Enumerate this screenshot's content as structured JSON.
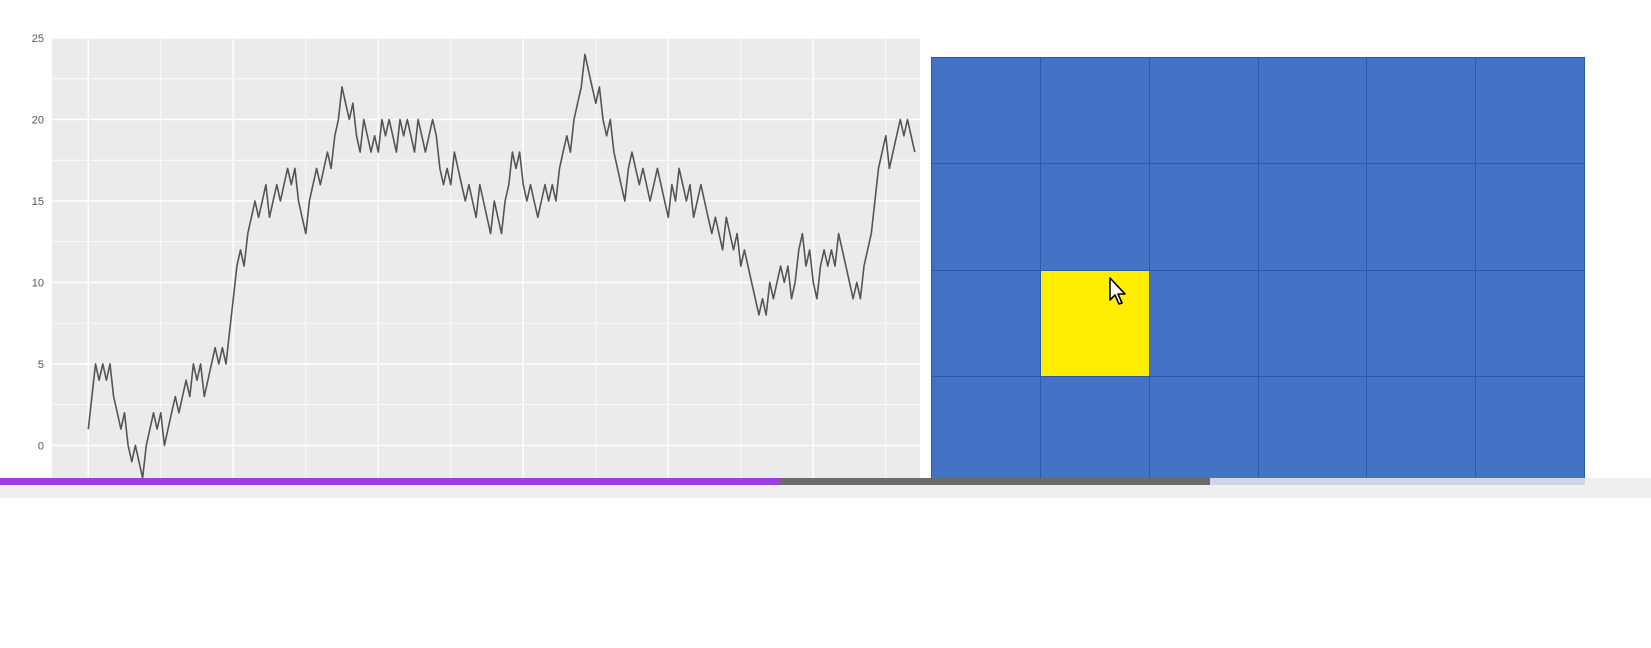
{
  "chart_data": {
    "type": "line",
    "title": "",
    "xlabel": "",
    "ylabel": "",
    "ylim": [
      -2,
      25
    ],
    "yticks": [
      0,
      5,
      10,
      15,
      20,
      25
    ],
    "xlim": [
      0,
      240
    ],
    "grid": true,
    "series": [
      {
        "color": "#555555",
        "values": [
          1,
          3,
          5,
          4,
          5,
          4,
          5,
          3,
          2,
          1,
          2,
          0,
          -1,
          0,
          -1,
          -2,
          0,
          1,
          2,
          1,
          2,
          0,
          1,
          2,
          3,
          2,
          3,
          4,
          3,
          5,
          4,
          5,
          3,
          4,
          5,
          6,
          5,
          6,
          5,
          7,
          9,
          11,
          12,
          11,
          13,
          14,
          15,
          14,
          15,
          16,
          14,
          15,
          16,
          15,
          16,
          17,
          16,
          17,
          15,
          14,
          13,
          15,
          16,
          17,
          16,
          17,
          18,
          17,
          19,
          20,
          22,
          21,
          20,
          21,
          19,
          18,
          20,
          19,
          18,
          19,
          18,
          20,
          19,
          20,
          19,
          18,
          20,
          19,
          20,
          19,
          18,
          20,
          19,
          18,
          19,
          20,
          19,
          17,
          16,
          17,
          16,
          18,
          17,
          16,
          15,
          16,
          15,
          14,
          16,
          15,
          14,
          13,
          15,
          14,
          13,
          15,
          16,
          18,
          17,
          18,
          16,
          15,
          16,
          15,
          14,
          15,
          16,
          15,
          16,
          15,
          17,
          18,
          19,
          18,
          20,
          21,
          22,
          24,
          23,
          22,
          21,
          22,
          20,
          19,
          20,
          18,
          17,
          16,
          15,
          17,
          18,
          17,
          16,
          17,
          16,
          15,
          16,
          17,
          16,
          15,
          14,
          16,
          15,
          17,
          16,
          15,
          16,
          14,
          15,
          16,
          15,
          14,
          13,
          14,
          13,
          12,
          14,
          13,
          12,
          13,
          11,
          12,
          11,
          10,
          9,
          8,
          9,
          8,
          10,
          9,
          10,
          11,
          10,
          11,
          9,
          10,
          12,
          13,
          11,
          12,
          10,
          9,
          11,
          12,
          11,
          12,
          11,
          13,
          12,
          11,
          10,
          9,
          10,
          9,
          11,
          12,
          13,
          15,
          17,
          18,
          19,
          17,
          18,
          19,
          20,
          19,
          20,
          19,
          18
        ]
      }
    ]
  },
  "board": {
    "columns": 6,
    "rows": 4,
    "cell_color": "#4472c4",
    "grid_line_color": "#2a5aa8",
    "highlight_color": "#ffee00",
    "highlighted_cell": {
      "row": 3,
      "column": 2
    }
  },
  "cursor": {
    "icon": "mouse-pointer-icon"
  },
  "progress": {
    "played_fraction": 0.472,
    "buffered_fraction": 0.733,
    "played_color": "#9b3fe0",
    "buffered_color": "#6b6b6b"
  }
}
